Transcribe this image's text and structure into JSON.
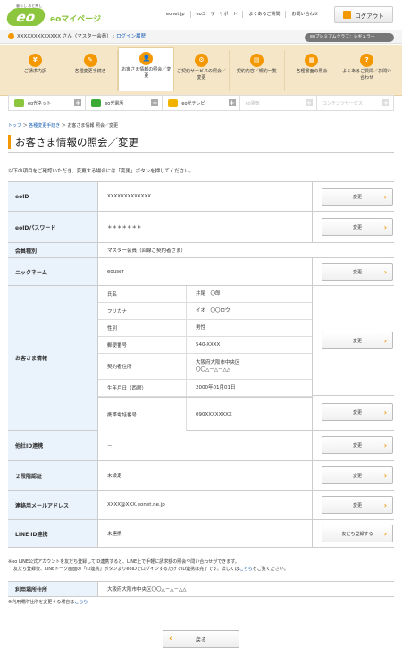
{
  "header": {
    "logo_tagline": "暮らし あと押し",
    "logo_mark": "eo",
    "site_name": "eoマイページ",
    "links": [
      "eonet.jp",
      "eoユーザーサポート",
      "よくあるご質問",
      "お問い合わせ"
    ],
    "logout": "ログアウト"
  },
  "userbar": {
    "user": "XXXXXXXXXXXXX さん（マスター会員）",
    "login_history": "ログイン履歴",
    "premium": "eoプレミアムクラブ：レギュラー"
  },
  "menu": [
    {
      "icon": "¥",
      "label": "ご請求内訳"
    },
    {
      "icon": "✎",
      "label": "各種変更手続き"
    },
    {
      "icon": "👤",
      "label": "お客さま情報の照会／変更"
    },
    {
      "icon": "⚙",
      "label": "ご契約サービスの照会／変更"
    },
    {
      "icon": "▤",
      "label": "契約内容／規約一覧"
    },
    {
      "icon": "▦",
      "label": "各種書面の照会"
    },
    {
      "icon": "?",
      "label": "よくあるご質問／お問い合わせ"
    }
  ],
  "services": [
    {
      "label": "eo光ネット",
      "color": "#8cc63f",
      "enabled": true
    },
    {
      "label": "eo光電話",
      "color": "#3aaa35",
      "enabled": true
    },
    {
      "label": "eo光テレビ",
      "color": "#f0b400",
      "enabled": true
    },
    {
      "label": "eo電気",
      "color": "#cccccc",
      "enabled": false
    },
    {
      "label": "コンテンツサービス",
      "color": "#e9c9a9",
      "enabled": false
    }
  ],
  "breadcrumb": {
    "home": "トップ",
    "parent": "各種変更手続き",
    "current": "お客さま情報 照会／変更"
  },
  "page_title": "お客さま情報の照会／変更",
  "lead": "以下の項目をご確認いただき、変更する場合には「変更」ボタンを押してください。",
  "rows": {
    "eoid": {
      "label": "eoID",
      "value": "XXXXXXXXXXXXX",
      "button": "変更"
    },
    "password": {
      "label": "eoIDパスワード",
      "value": "＊＊＊＊＊＊＊",
      "button": "変更"
    },
    "member_type": {
      "label": "会員種別",
      "value": "マスター会員（回線ご契約者さま）"
    },
    "nickname": {
      "label": "ニックネーム",
      "value": "eouser",
      "button": "変更"
    },
    "customer": {
      "label": "お客さま情報",
      "button": "変更",
      "fields": [
        {
          "k": "氏名",
          "v": "井尾　〇郎"
        },
        {
          "k": "フリガナ",
          "v": "イオ　〇〇ロウ"
        },
        {
          "k": "性別",
          "v": "男性"
        },
        {
          "k": "郵便番号",
          "v": "540-XXXX"
        },
        {
          "k": "契約者住所",
          "v": "大阪府大阪市中央区\n〇〇△－△－△△"
        },
        {
          "k": "生年月日（西暦）",
          "v": "2000年01月01日"
        }
      ],
      "phone": {
        "k": "携帯電話番号",
        "v": "090XXXXXXXX",
        "button": "変更"
      }
    },
    "other_id": {
      "label": "他社ID連携",
      "value": "－",
      "button": "変更"
    },
    "two_factor": {
      "label": "２段階認証",
      "value": "未設定",
      "button": "変更"
    },
    "email": {
      "label": "連絡用メールアドレス",
      "value": "XXXX@XXX.eonet.ne.jp",
      "button": "変更"
    },
    "line": {
      "label": "LINE ID連携",
      "value": "未連携",
      "button": "友だち登録する"
    }
  },
  "line_note": {
    "line1": "※eo LINE公式アカウントを友だち登録してID連携すると、LINE上で手軽に請求額の照会や問い合わせができます。",
    "line2": "友だち登録後、LINEトーク画面の「ID連携」ボタンよりeoIDでログインするだけでID連携は完了です。詳しくは",
    "link": "こちら",
    "tail": "をご覧ください。"
  },
  "usage_address": {
    "label": "利用場所住所",
    "value": "大阪府大阪市中央区〇〇△－△－△△"
  },
  "usage_note": {
    "text": "※利用場所住所を変更する場合は",
    "link": "こちら"
  },
  "back": "戻る"
}
